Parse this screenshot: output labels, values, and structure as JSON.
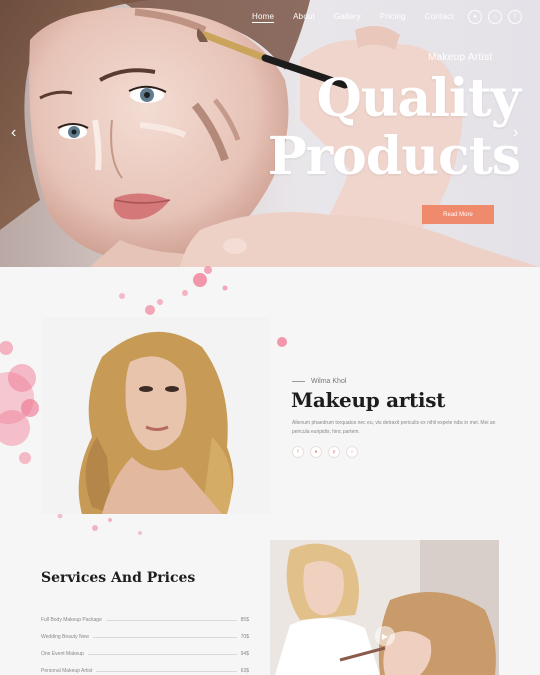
{
  "nav": {
    "items": [
      {
        "label": "Home",
        "active": true
      },
      {
        "label": "About",
        "active": false
      },
      {
        "label": "Gallery",
        "active": false
      },
      {
        "label": "Pricing",
        "active": false
      },
      {
        "label": "Contact",
        "active": false
      }
    ]
  },
  "social": [
    "twitter-icon",
    "instagram-icon",
    "facebook-icon"
  ],
  "hero": {
    "kicker": "Makeup Artist",
    "title_line1": "Quality",
    "title_line2": "Products",
    "button": "Read More"
  },
  "about": {
    "kicker": "Wilma Khol",
    "title": "Makeup artist",
    "text": "Allenum phaedrum torquatos nec eu, vis detraxit periculis ex nihil expete ndis in mei. Mei an pericula euripidis, hinc partem."
  },
  "services": {
    "title": "Services And Prices",
    "items": [
      {
        "name": "Full Body Makeup Package",
        "price": "85$"
      },
      {
        "name": "Wedding Beauty New",
        "price": "70$"
      },
      {
        "name": "One Event Makeup",
        "price": "94$"
      },
      {
        "name": "Personal Makeup Artist",
        "price": "63$"
      }
    ]
  },
  "colors": {
    "accent": "#f08a6d",
    "splash": "#ef6f8a",
    "heading": "#1d1d1d"
  }
}
